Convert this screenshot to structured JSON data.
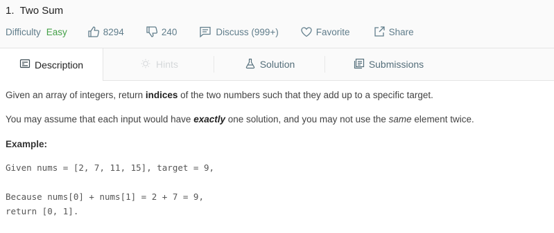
{
  "problem": {
    "number": "1.",
    "title": "Two Sum"
  },
  "meta": {
    "difficulty_label": "Difficulty",
    "difficulty_value": "Easy",
    "likes": "8294",
    "dislikes": "240",
    "discuss": "Discuss (999+)",
    "favorite": "Favorite",
    "share": "Share"
  },
  "tabs": [
    {
      "label": "Description",
      "icon": "description-icon",
      "state": "active"
    },
    {
      "label": "Hints",
      "icon": "lightbulb-icon",
      "state": "disabled"
    },
    {
      "label": "Solution",
      "icon": "flask-icon",
      "state": "normal"
    },
    {
      "label": "Submissions",
      "icon": "submissions-icon",
      "state": "normal"
    }
  ],
  "description": {
    "p1_before": "Given an array of integers, return ",
    "p1_bold": "indices",
    "p1_after": " of the two numbers such that they add up to a specific target.",
    "p2_before": "You may assume that each input would have ",
    "p2_bold_italic": "exactly",
    "p2_middle": " one solution, and you may not use the ",
    "p2_italic": "same",
    "p2_after": " element twice.",
    "example_heading": "Example:",
    "code_line1": "Given nums = [2, 7, 11, 15], target = 9,",
    "code_line2": "Because nums[0] + nums[1] = 2 + 7 = 9,",
    "code_line3": "return [0, 1]."
  },
  "colors": {
    "easy": "#43a047",
    "meta_text": "#607d8b",
    "header_bg": "#fafafa"
  }
}
